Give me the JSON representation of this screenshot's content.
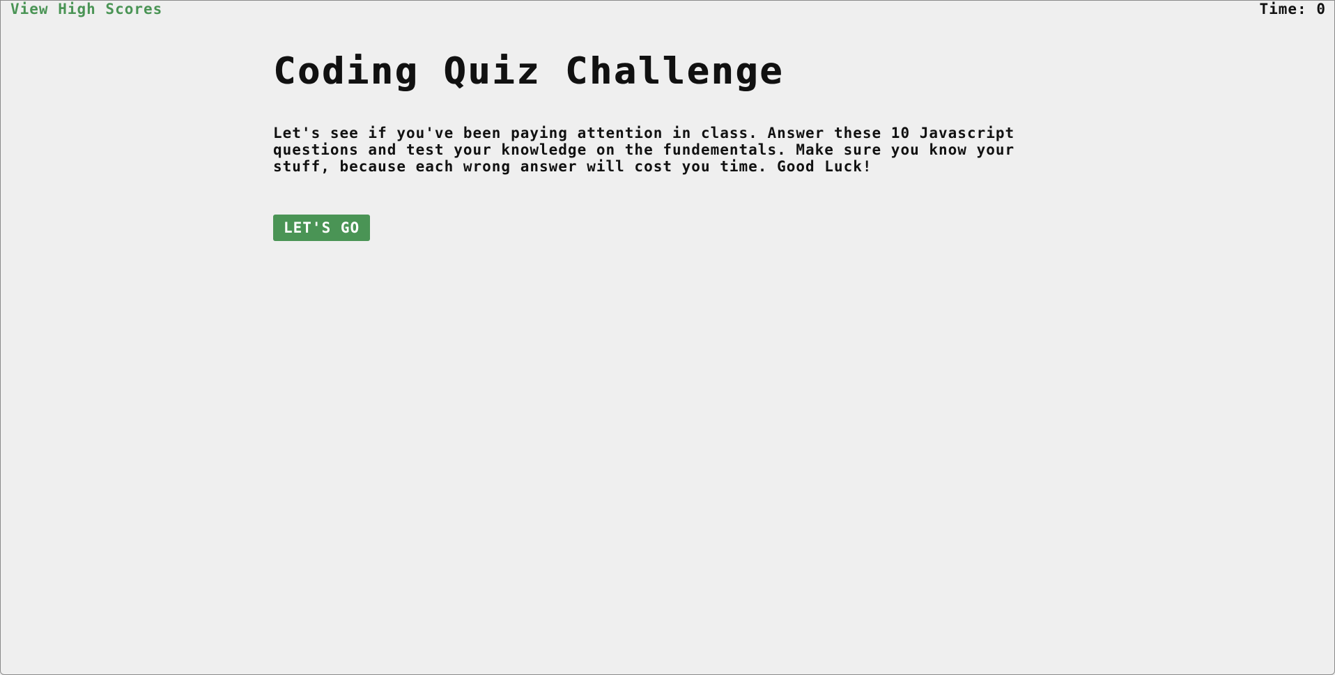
{
  "header": {
    "high_scores_link": "View High Scores",
    "timer_label": "Time:",
    "timer_value": "0"
  },
  "main": {
    "title": "Coding Quiz Challenge",
    "intro": "Let's see if you've been paying attention in class. Answer these 10 Javascript questions and test your knowledge on the fundementals. Make sure you know your stuff, because each wrong answer will cost you time. Good Luck!",
    "start_button": "LET'S GO"
  },
  "colors": {
    "accent_green": "#4a9455",
    "background": "#efefef",
    "text": "#111111"
  }
}
